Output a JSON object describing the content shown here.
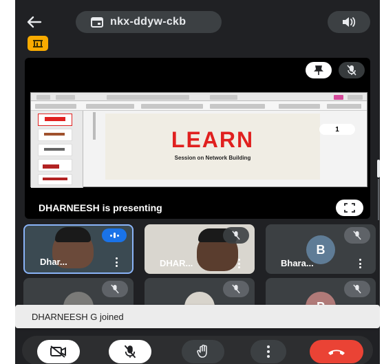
{
  "meeting": {
    "code": "nkx-ddyw-ckb"
  },
  "presentation": {
    "presenter_text": "DHARNEESH is presenting",
    "slide_title": "LEARN",
    "slide_subtitle": "Session on Network Building",
    "page_number": "1"
  },
  "participants": [
    {
      "name": "Dhar...",
      "type": "video"
    },
    {
      "name": "DHAR...",
      "type": "video"
    },
    {
      "name": "Bhara...",
      "type": "avatar",
      "initial": "B",
      "color": "#5f7c96"
    },
    {
      "name": "",
      "type": "photo"
    },
    {
      "name": "",
      "type": "photo"
    },
    {
      "name": "",
      "type": "avatar",
      "initial": "P",
      "color": "#b07a78"
    }
  ],
  "toast": {
    "message": "DHARNEESH G joined"
  },
  "colors": {
    "accent": "#8ab4f8",
    "end_call": "#ea4335",
    "background": "#202124",
    "badge": "#f9ab00",
    "slide_title": "#e0201f"
  },
  "icons": [
    "back-arrow-icon",
    "calendar-icon",
    "speaker-icon",
    "pin-icon",
    "mic-off-icon",
    "fullscreen-icon",
    "camera-off-icon",
    "raise-hand-icon",
    "more-vert-icon",
    "end-call-icon"
  ]
}
